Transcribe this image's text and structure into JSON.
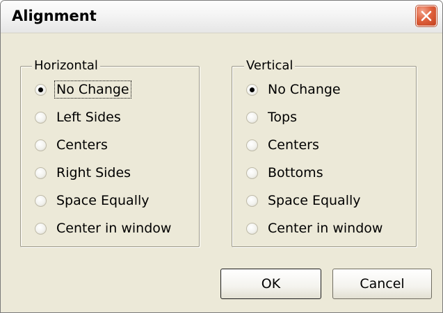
{
  "dialog": {
    "title": "Alignment"
  },
  "horizontal": {
    "legend": "Horizontal",
    "options": [
      {
        "label": "No Change",
        "checked": true
      },
      {
        "label": "Left Sides",
        "checked": false
      },
      {
        "label": "Centers",
        "checked": false
      },
      {
        "label": "Right Sides",
        "checked": false
      },
      {
        "label": "Space Equally",
        "checked": false
      },
      {
        "label": "Center in window",
        "checked": false
      }
    ]
  },
  "vertical": {
    "legend": "Vertical",
    "options": [
      {
        "label": "No Change",
        "checked": true
      },
      {
        "label": "Tops",
        "checked": false
      },
      {
        "label": "Centers",
        "checked": false
      },
      {
        "label": "Bottoms",
        "checked": false
      },
      {
        "label": "Space Equally",
        "checked": false
      },
      {
        "label": "Center in window",
        "checked": false
      }
    ]
  },
  "buttons": {
    "ok": "OK",
    "cancel": "Cancel"
  },
  "colors": {
    "dialog_bg": "#ece9d8",
    "close_button": "#e0623e"
  },
  "icons": {
    "close": "close-icon"
  }
}
